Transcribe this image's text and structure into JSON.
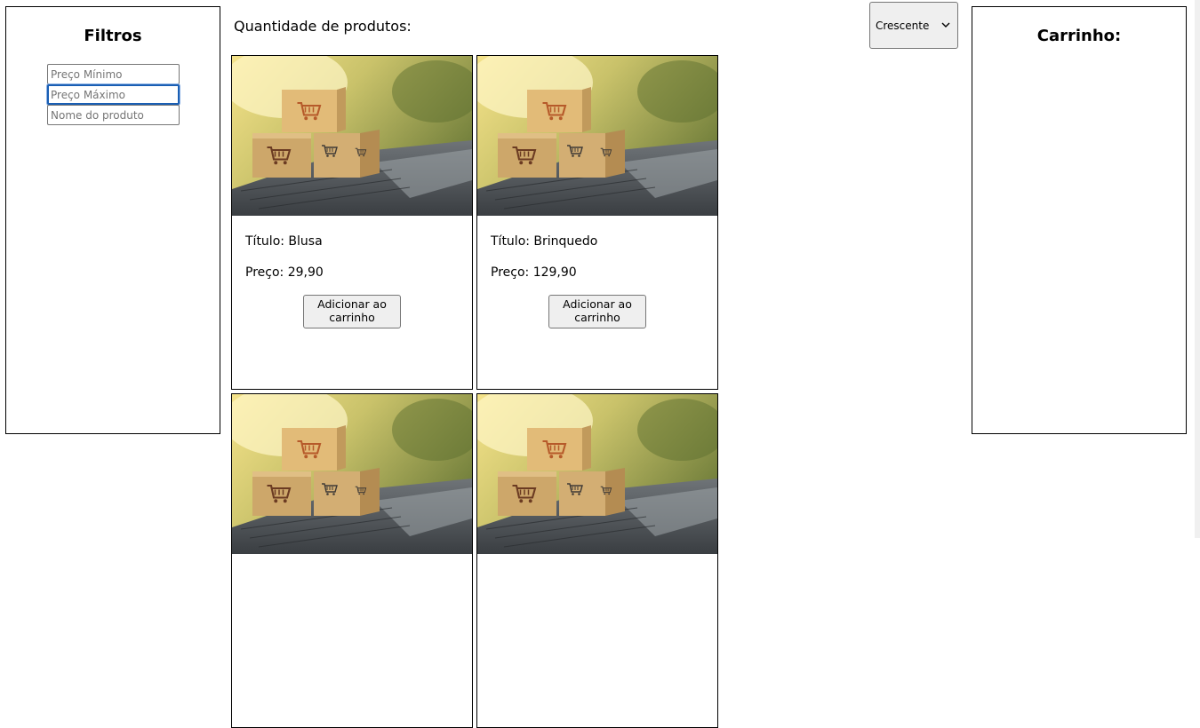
{
  "filters": {
    "title": "Filtros",
    "min_price_placeholder": "Preço Mínimo",
    "max_price_placeholder": "Preço Máximo",
    "name_placeholder": "Nome do produto"
  },
  "main": {
    "count_label": "Quantidade de produtos:",
    "sort_selected": "Crescente"
  },
  "products": [
    {
      "title": "Título: Blusa",
      "price": "Preço: 29,90",
      "button": "Adicionar ao carrinho"
    },
    {
      "title": "Título: Brinquedo",
      "price": "Preço: 129,90",
      "button": "Adicionar ao carrinho"
    },
    {
      "title": "",
      "price": "",
      "button": ""
    },
    {
      "title": "",
      "price": "",
      "button": ""
    }
  ],
  "cart": {
    "title": "Carrinho:"
  }
}
